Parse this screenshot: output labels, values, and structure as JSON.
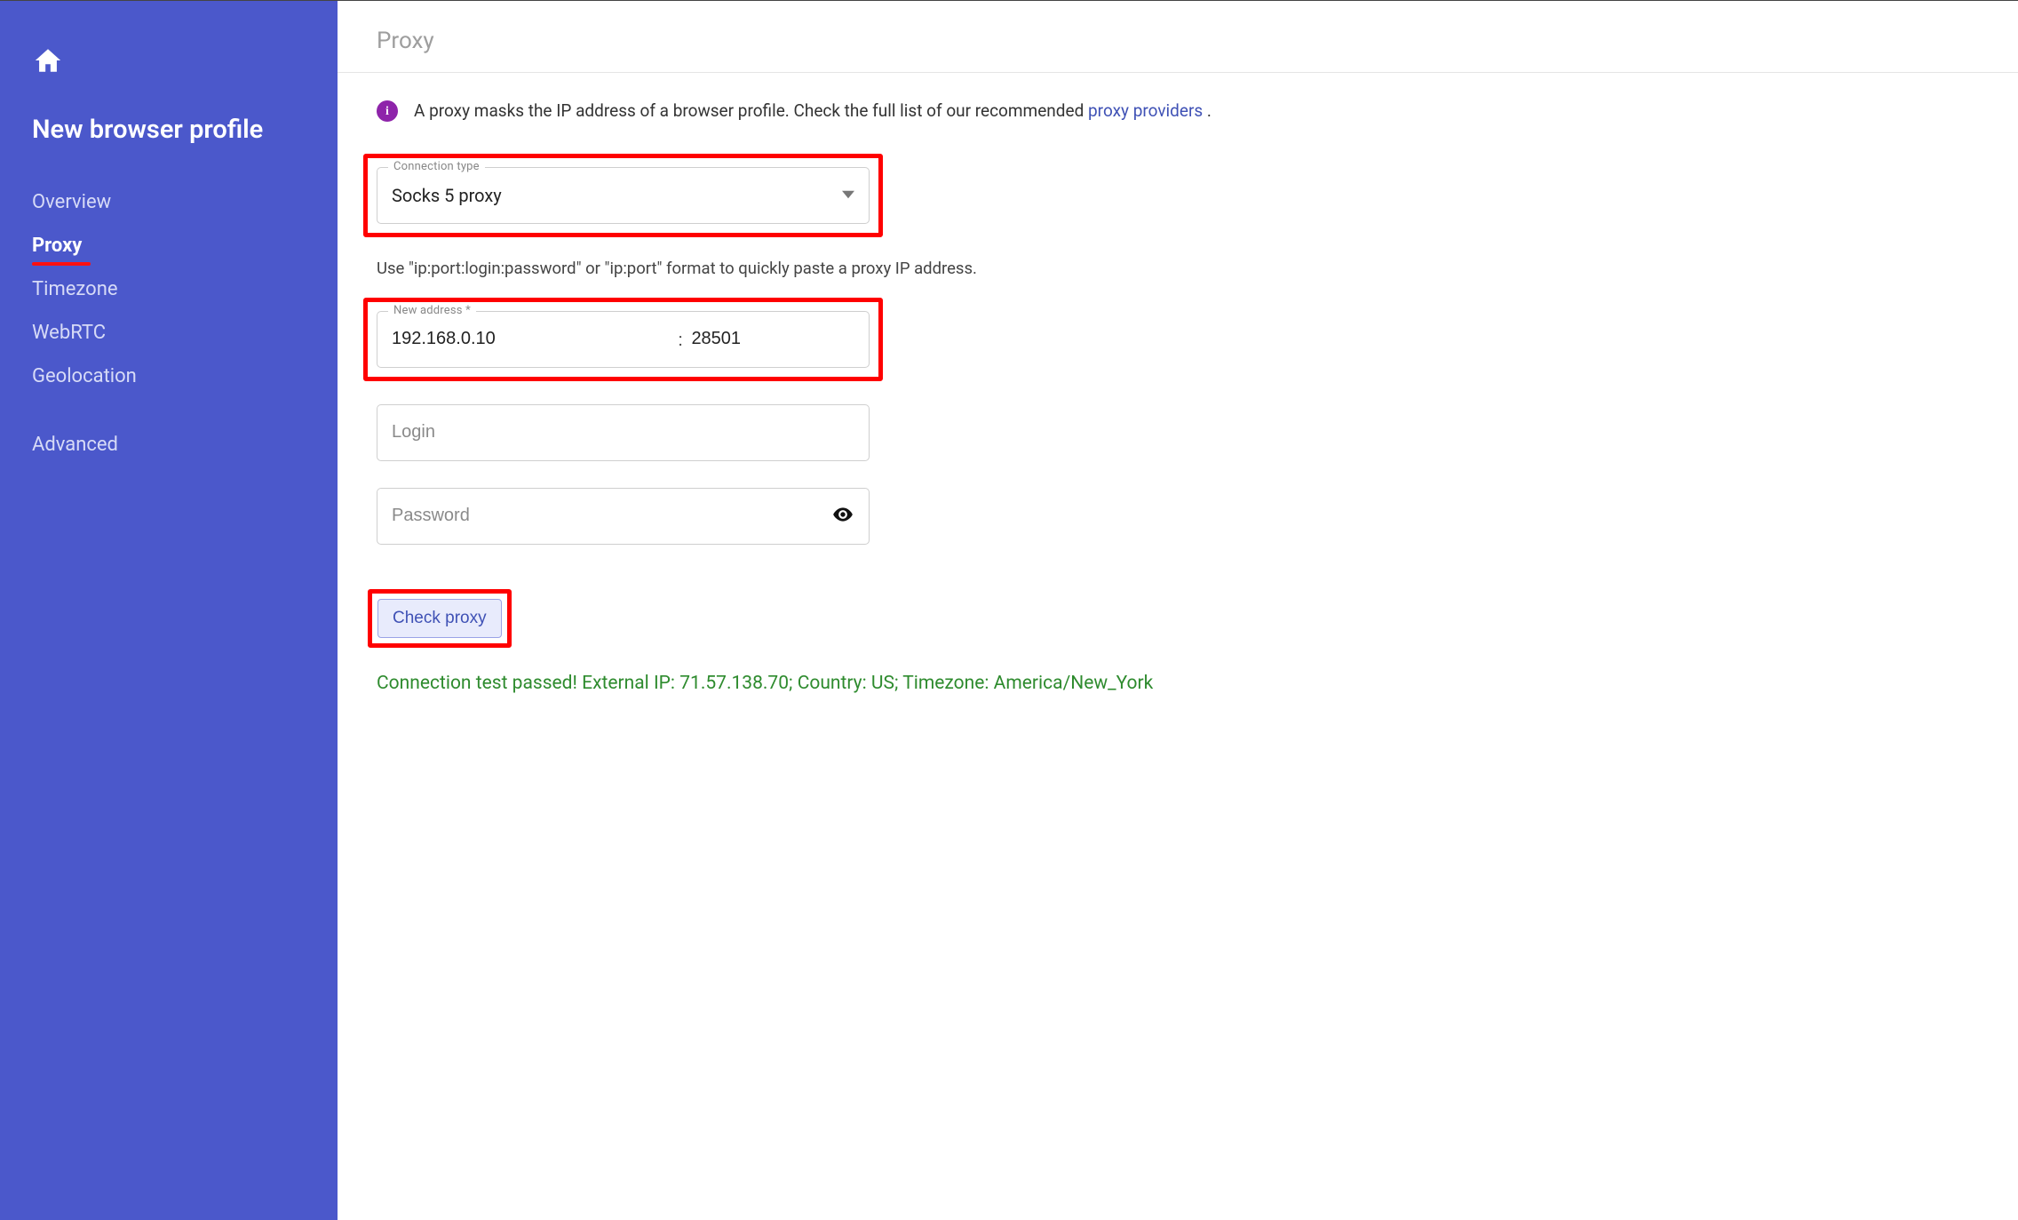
{
  "sidebar": {
    "page_title": "New browser profile",
    "items": [
      {
        "label": "Overview",
        "active": false
      },
      {
        "label": "Proxy",
        "active": true
      },
      {
        "label": "Timezone",
        "active": false
      },
      {
        "label": "WebRTC",
        "active": false
      },
      {
        "label": "Geolocation",
        "active": false
      }
    ],
    "advanced_label": "Advanced"
  },
  "header": {
    "title": "Proxy"
  },
  "info": {
    "badge_glyph": "i",
    "text": "A proxy masks the IP address of a browser profile. Check the full list of our recommended ",
    "link_text": "proxy providers",
    "trailing": " ."
  },
  "connection_type": {
    "label": "Connection type",
    "value": "Socks 5 proxy"
  },
  "paste_hint": "Use \"ip:port:login:password\" or \"ip:port\" format to quickly paste a proxy IP address.",
  "address": {
    "label": "New address *",
    "ip": "192.168.0.10",
    "port": "28501"
  },
  "login": {
    "placeholder": "Login",
    "value": ""
  },
  "password": {
    "placeholder": "Password",
    "value": ""
  },
  "check_button": "Check proxy",
  "result": "Connection test passed! External IP: 71.57.138.70; Country: US; Timezone: America/New_York"
}
